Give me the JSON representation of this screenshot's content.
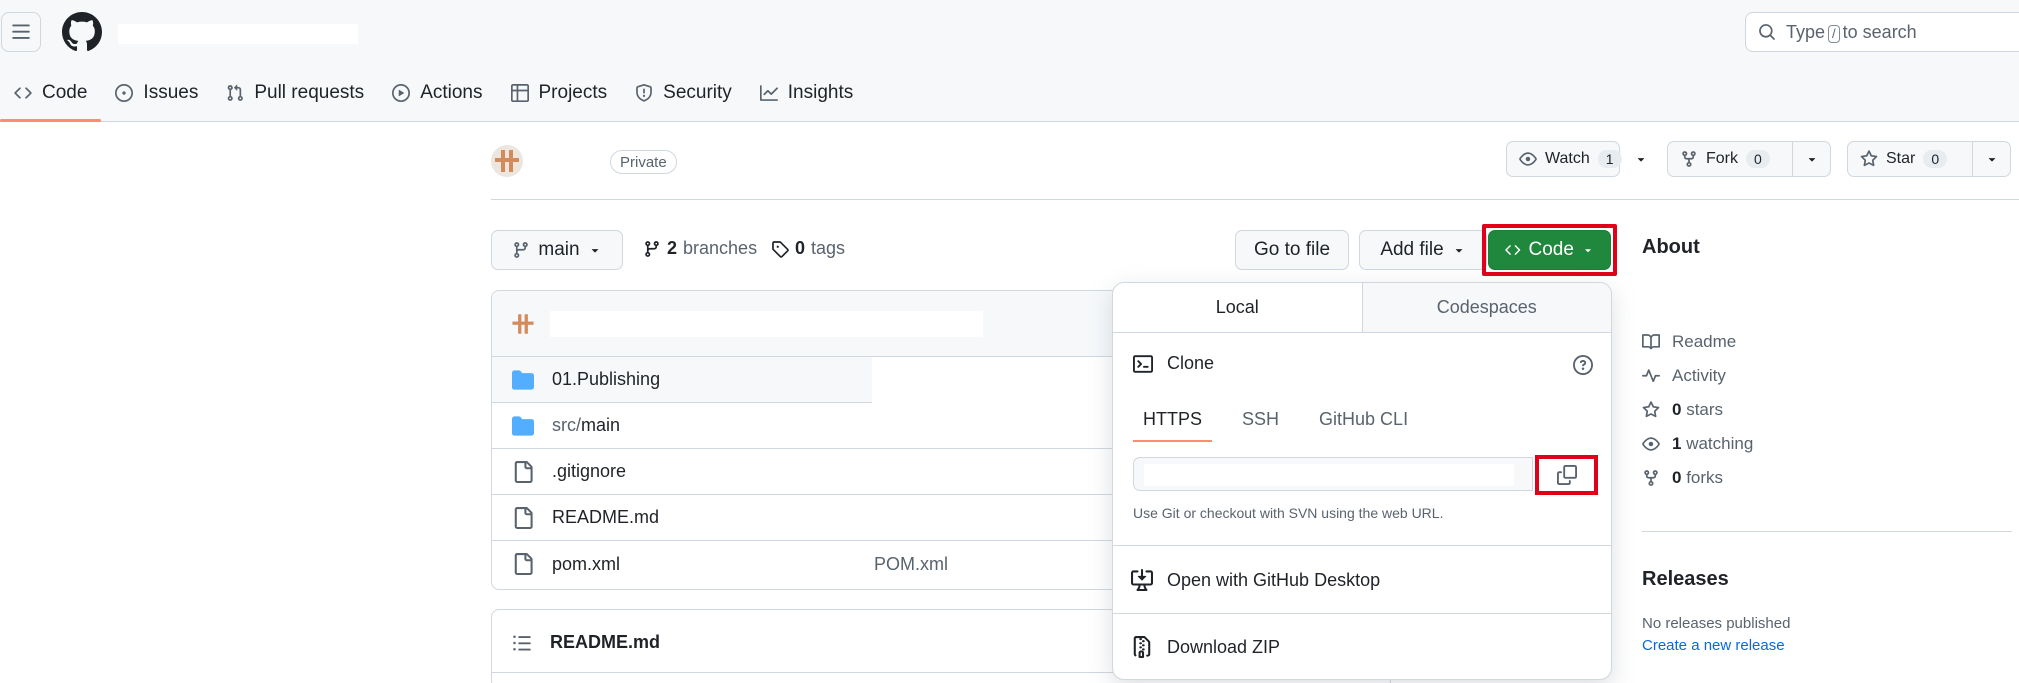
{
  "header": {
    "search_placeholder_pre": "Type",
    "search_key": "/",
    "search_placeholder_post": "to search"
  },
  "nav_tabs": [
    {
      "label": "Code"
    },
    {
      "label": "Issues"
    },
    {
      "label": "Pull requests"
    },
    {
      "label": "Actions"
    },
    {
      "label": "Projects"
    },
    {
      "label": "Security"
    },
    {
      "label": "Insights"
    }
  ],
  "repo": {
    "visibility": "Private",
    "watch": {
      "label": "Watch",
      "count": "1"
    },
    "fork": {
      "label": "Fork",
      "count": "0"
    },
    "star": {
      "label": "Star",
      "count": "0"
    }
  },
  "file_nav": {
    "branch": "main",
    "branches_count": "2",
    "branches_label": "branches",
    "tags_count": "0",
    "tags_label": "tags",
    "go_to_file": "Go to file",
    "add_file": "Add file",
    "code": "Code"
  },
  "files": [
    {
      "type": "folder",
      "name": "01.Publishing",
      "message": ""
    },
    {
      "type": "folder",
      "name_prefix": "src/",
      "name": "main",
      "message": ""
    },
    {
      "type": "file",
      "name": ".gitignore",
      "message": ""
    },
    {
      "type": "file",
      "name": "README.md",
      "message": ""
    },
    {
      "type": "file",
      "name": "pom.xml",
      "message": "POM.xml"
    }
  ],
  "readme_box": {
    "title": "README.md"
  },
  "clone_dropdown": {
    "tab_local": "Local",
    "tab_codespaces": "Codespaces",
    "clone_title": "Clone",
    "subtabs": [
      "HTTPS",
      "SSH",
      "GitHub CLI"
    ],
    "url_hint": "Use Git or checkout with SVN using the web URL.",
    "open_desktop": "Open with GitHub Desktop",
    "download_zip": "Download ZIP"
  },
  "sidebar": {
    "about": "About",
    "items": [
      {
        "label": "Readme"
      },
      {
        "label": "Activity"
      },
      {
        "count": "0",
        "label": "stars"
      },
      {
        "count": "1",
        "label": "watching"
      },
      {
        "count": "0",
        "label": "forks"
      }
    ],
    "releases_title": "Releases",
    "no_releases": "No releases published",
    "create_release": "Create a new release"
  },
  "colors": {
    "accent_green": "#1f883d",
    "tab_underline": "#fd8c73",
    "highlight_red": "#e0001a",
    "link_blue": "#0969da",
    "folder_blue": "#54aeff"
  }
}
